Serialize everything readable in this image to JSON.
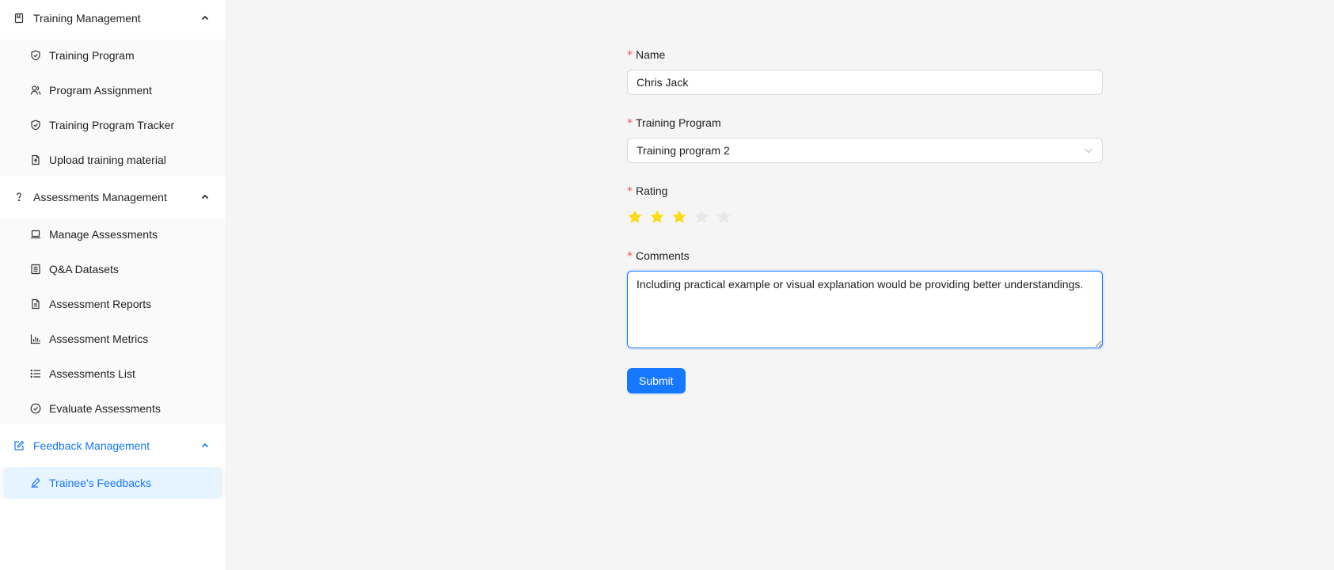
{
  "sidebar": {
    "groups": [
      {
        "label": "Training Management",
        "icon": "book-icon",
        "expanded": true,
        "items": [
          {
            "label": "Training Program",
            "icon": "shield-check-icon"
          },
          {
            "label": "Program Assignment",
            "icon": "users-icon"
          },
          {
            "label": "Training Program Tracker",
            "icon": "shield-check-icon"
          },
          {
            "label": "Upload training material",
            "icon": "file-upload-icon"
          }
        ]
      },
      {
        "label": "Assessments Management",
        "icon": "question-icon",
        "expanded": true,
        "items": [
          {
            "label": "Manage Assessments",
            "icon": "laptop-icon"
          },
          {
            "label": "Q&A Datasets",
            "icon": "list-box-icon"
          },
          {
            "label": "Assessment Reports",
            "icon": "file-text-icon"
          },
          {
            "label": "Assessment Metrics",
            "icon": "bar-chart-icon"
          },
          {
            "label": "Assessments List",
            "icon": "list-icon"
          },
          {
            "label": "Evaluate Assessments",
            "icon": "check-circle-icon"
          }
        ]
      },
      {
        "label": "Feedback Management",
        "icon": "edit-icon",
        "expanded": true,
        "active": true,
        "items": [
          {
            "label": "Trainee's Feedbacks",
            "icon": "signature-icon",
            "selected": true
          }
        ]
      }
    ]
  },
  "form": {
    "name": {
      "label": "Name",
      "value": "Chris Jack"
    },
    "training_program": {
      "label": "Training Program",
      "value": "Training program 2"
    },
    "rating": {
      "label": "Rating",
      "value": 3,
      "max": 5,
      "filled_color": "#fadb14",
      "empty_color": "#e8e8e8"
    },
    "comments": {
      "label": "Comments",
      "value": "Including practical example or visual explanation would be providing better understandings."
    },
    "submit_label": "Submit"
  },
  "colors": {
    "primary": "#1677ff",
    "required": "#ff4d4f",
    "selected_bg": "#e6f4ff"
  }
}
